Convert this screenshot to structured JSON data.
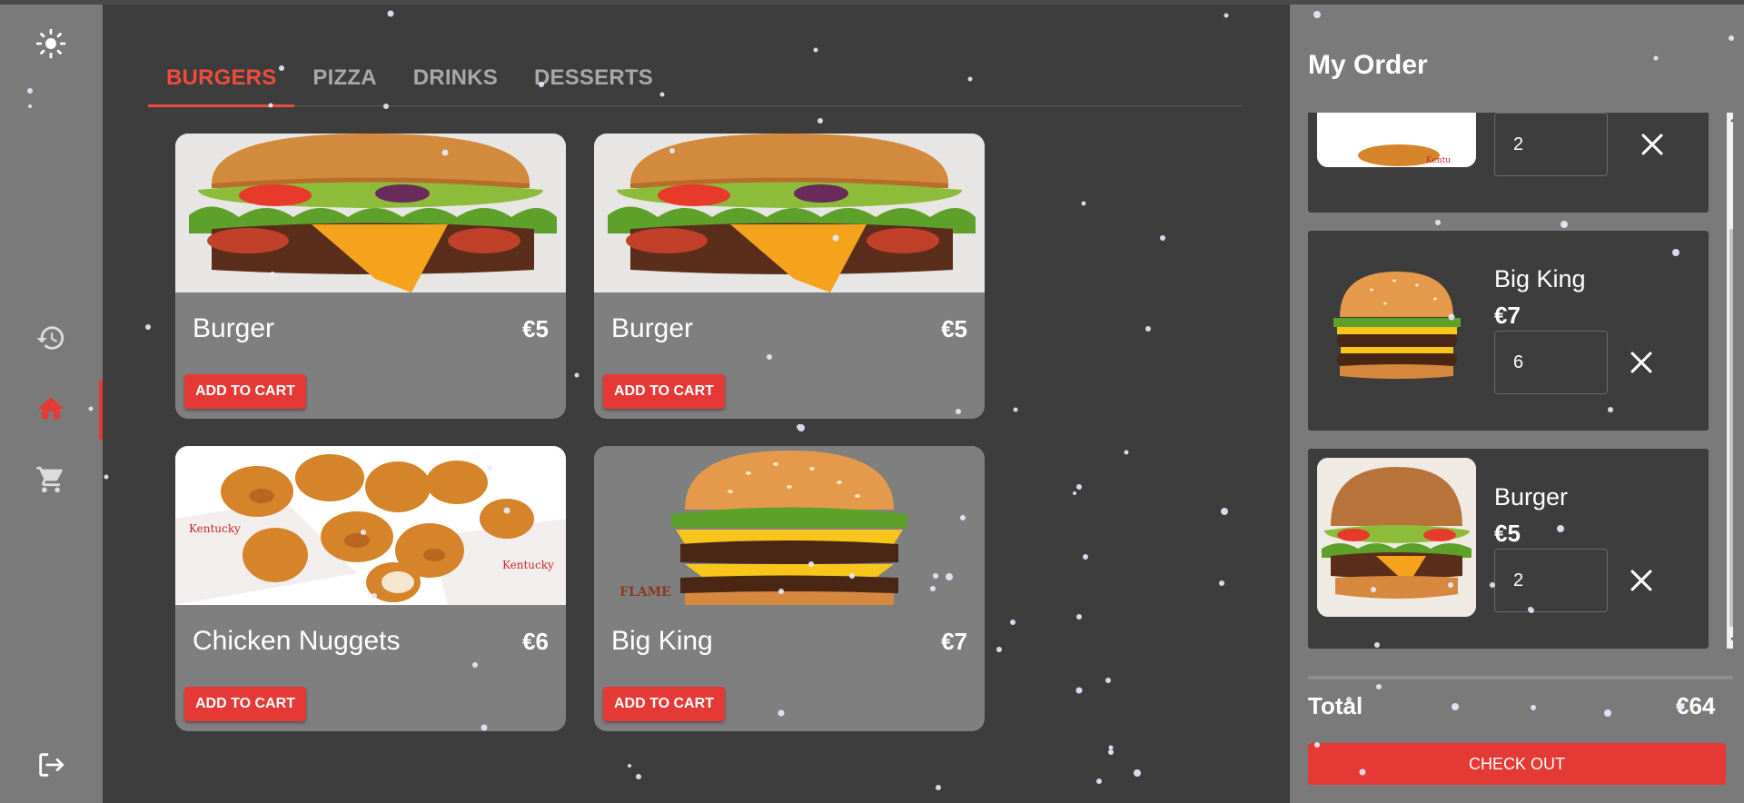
{
  "sidebar": {
    "items": [
      {
        "icon": "theme-toggle-icon"
      },
      {
        "icon": "history-icon"
      },
      {
        "icon": "home-icon",
        "active": true
      },
      {
        "icon": "cart-icon"
      },
      {
        "icon": "logout-icon"
      }
    ]
  },
  "menu": {
    "tabs": [
      {
        "label": "BURGERS",
        "active": true
      },
      {
        "label": "PIZZA"
      },
      {
        "label": "DRINKS"
      },
      {
        "label": "DESSERTS"
      }
    ],
    "products": [
      {
        "name": "Burger",
        "price": "€5",
        "button": "ADD TO CART",
        "image": "burger-photo"
      },
      {
        "name": "Burger",
        "price": "€5",
        "button": "ADD TO CART",
        "image": "burger-photo"
      },
      {
        "name": "Chicken Nuggets",
        "price": "€6",
        "button": "ADD TO CART",
        "image": "chicken-nuggets-photo"
      },
      {
        "name": "Big King",
        "price": "€7",
        "button": "ADD TO CART",
        "image": "big-king-photo"
      }
    ]
  },
  "order": {
    "title": "My Order",
    "items": [
      {
        "name": "",
        "price": "",
        "quantity": "2"
      },
      {
        "name": "Big King",
        "price": "€7",
        "quantity": "6"
      },
      {
        "name": "Burger",
        "price": "€5",
        "quantity": "2"
      }
    ],
    "total_label": "Total",
    "total_value": "€64",
    "checkout_label": "CHECK OUT"
  },
  "colors": {
    "accent": "#e53935",
    "tab_active": "#ef4c3c",
    "sidebar_bg": "#7a7a7a",
    "main_bg": "#3d3d3d"
  }
}
